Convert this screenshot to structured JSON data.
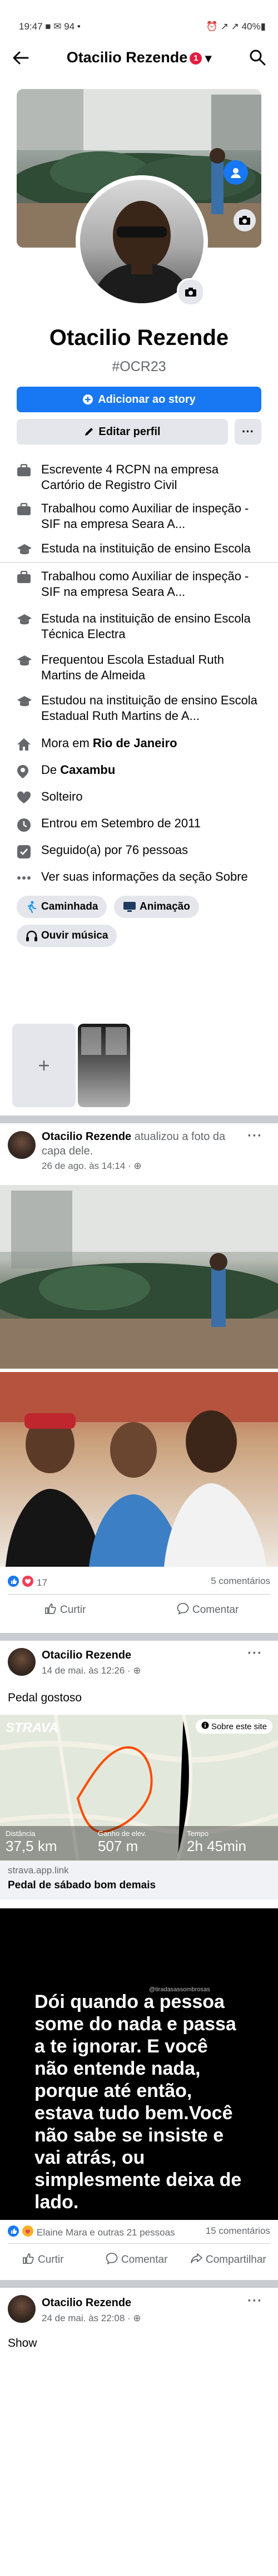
{
  "status_bar": {
    "time": "19:47",
    "left_icons": "■ ✉ 94 •",
    "right_icons": "⏰ ↗ ↗ 40%▮"
  },
  "header": {
    "title": "Otacilio Rezende",
    "badge_count": "1",
    "dropdown": "▾"
  },
  "profile": {
    "name": "Otacilio Rezende",
    "handle": "#OCR23"
  },
  "buttons": {
    "add_story": "Adicionar ao story",
    "edit_profile": "Editar perfil",
    "more": "···"
  },
  "info_items": [
    {
      "text": "Escrevente 4 RCPN na empresa Cartório de Registro Civil"
    },
    {
      "text": "Trabalhou como Auxiliar de inspeção - SIF na empresa Seara A..."
    },
    {
      "text": "Estuda na instituição de ensino Escola Técnica Electra"
    },
    {
      "text": "Trabalhou como Auxiliar de inspeção - SIF na empresa Seara A..."
    },
    {
      "text": "Estuda na instituição de ensino Escola Técnica Electra"
    },
    {
      "text": "Frequentou Escola Estadual Ruth Martins de Almeida"
    },
    {
      "text": "Estudou na instituição de ensino Escola Estadual Ruth Martins de A..."
    },
    {
      "prefix": "Mora em ",
      "bold": "Rio de Janeiro"
    },
    {
      "prefix": "De ",
      "bold": "Caxambu"
    },
    {
      "text": "Solteiro"
    },
    {
      "text": "Entrou em Setembro de 2011"
    },
    {
      "text": "Seguido(a) por 76 pessoas"
    },
    {
      "text": "Ver suas informações da seção Sobre"
    }
  ],
  "hobbies": [
    "Caminhada",
    "Animação",
    "Ouvir música"
  ],
  "add_thumb_plus": "+",
  "post1": {
    "name": "Otacilio Rezende",
    "action": " atualizou a foto da capa dele.",
    "meta": "26 de ago. às 14:14 · ⊕",
    "reactions": "17",
    "comments": "5 comentários",
    "like": "Curtir",
    "comment": "Comentar"
  },
  "post2": {
    "name": "Otacilio Rezende",
    "meta": "14 de mai. às 12:26 · ⊕",
    "text": "Pedal gostoso",
    "strava_logo": "STRAVA",
    "about_site": "Sobre este site",
    "stats": [
      {
        "label": "Distância",
        "value": "37,5 km"
      },
      {
        "label": "Ganho de elev.",
        "value": "507 m"
      },
      {
        "label": "Tempo",
        "value": "2h 45min"
      }
    ],
    "link_domain": "strava.app.link",
    "link_title": "Pedal de sábado bom demais"
  },
  "post3": {
    "text": "Dói quando a pessoa some do nada e passa a te ignorar.  E você não entende nada, porque até então, estava tudo bem.Você não sabe se insiste e vai atrás, ou simplesmente deixa de lado.",
    "watermark": "@tiradasassombrosas",
    "reactions": "Elaine Mara e outras 21 pessoas",
    "comments": "15 comentários",
    "like": "Curtir",
    "comment": "Comentar",
    "share": "Compartilhar"
  },
  "post4": {
    "name": "Otacilio Rezende",
    "meta": "24 de mai. às 22:08 · ⊕",
    "text": "Show"
  },
  "colors": {
    "primary": "#1877f2",
    "secondary_bg": "#e4e6eb",
    "separator": "#c9ccd1",
    "muted_text": "#65676b",
    "strava_orange": "#fc4c02"
  }
}
